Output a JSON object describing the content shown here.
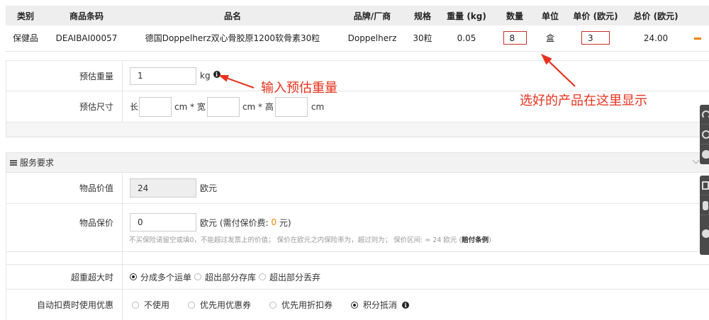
{
  "colors": {
    "text": "#333333",
    "header_bg": "#eeeeee",
    "border": "#e5e5e5",
    "accent_orange": "#f08300",
    "annotation_red": "#e8321e",
    "highlight_border": "#c9302c",
    "disabled_bg": "#eeeeee",
    "panel_head_bg": "#f2f2f2",
    "side_toolbar_bg": "#4a4a4a"
  },
  "product_table": {
    "headers": [
      "类别",
      "商品条码",
      "品名",
      "品牌/厂商",
      "规格",
      "重量 (kg)",
      "数量",
      "单位",
      "单价 (欧元)",
      "总价 (欧元)"
    ],
    "rows": [
      {
        "category": "保健品",
        "barcode": "DEAIBAI00057",
        "name": "德国Doppelherz双心骨胶原1200软骨素30粒",
        "brand": "Doppelherz",
        "spec": "30粒",
        "weight": "0.05",
        "quantity": "8",
        "unit": "盒",
        "unit_price": "3",
        "total": "24.00",
        "remove_icon": "minus-icon"
      }
    ]
  },
  "estimate": {
    "weight": {
      "label": "预估重量",
      "value": "1",
      "unit": "kg",
      "info_icon": "info-icon"
    },
    "size": {
      "label": "预估尺寸",
      "length_label": "长",
      "width_label": "cm * 宽",
      "height_label": "cm * 高",
      "unit": "cm"
    }
  },
  "annotations": {
    "weight_hint": "输入预估重量",
    "product_hint": "选好的产品在这里显示"
  },
  "service": {
    "title": "服务要求",
    "menu_icon": "menu-icon",
    "collapse_icon": "chevron-down-icon",
    "item_value": {
      "label": "物品价值",
      "value": "24",
      "unit": "欧元"
    },
    "insured": {
      "label": "物品保价",
      "value": "0",
      "unit_prefix": "欧元 (需付保价费: ",
      "fee": "0",
      "unit_suffix": " 元)",
      "note": "不买保险请留空或填0，不能超过发票上的价值； 保价在欧元之内保险率为，超过则为； 保价区间: ≈ 24 欧元 (",
      "note_link": "赔付条例",
      "note_end": ")"
    },
    "overweight": {
      "label": "超重超大时",
      "options": [
        {
          "label": "分成多个运单",
          "selected": true
        },
        {
          "label": "超出部分存库",
          "selected": false
        },
        {
          "label": "超出部分丢弃",
          "selected": false
        }
      ]
    },
    "auto_discount": {
      "label": "自动扣费时使用优惠",
      "options": [
        {
          "label": "不使用",
          "selected": false
        },
        {
          "label": "优先用优惠券",
          "selected": false
        },
        {
          "label": "优先用折扣券",
          "selected": false
        },
        {
          "label": "积分抵消",
          "selected": true
        }
      ],
      "info_icon": "info-icon"
    }
  },
  "side_toolbar": {
    "icons": [
      "headset-icon",
      "clock-icon",
      "qq-icon",
      "document-icon",
      "phone-icon",
      "wechat-icon"
    ]
  }
}
